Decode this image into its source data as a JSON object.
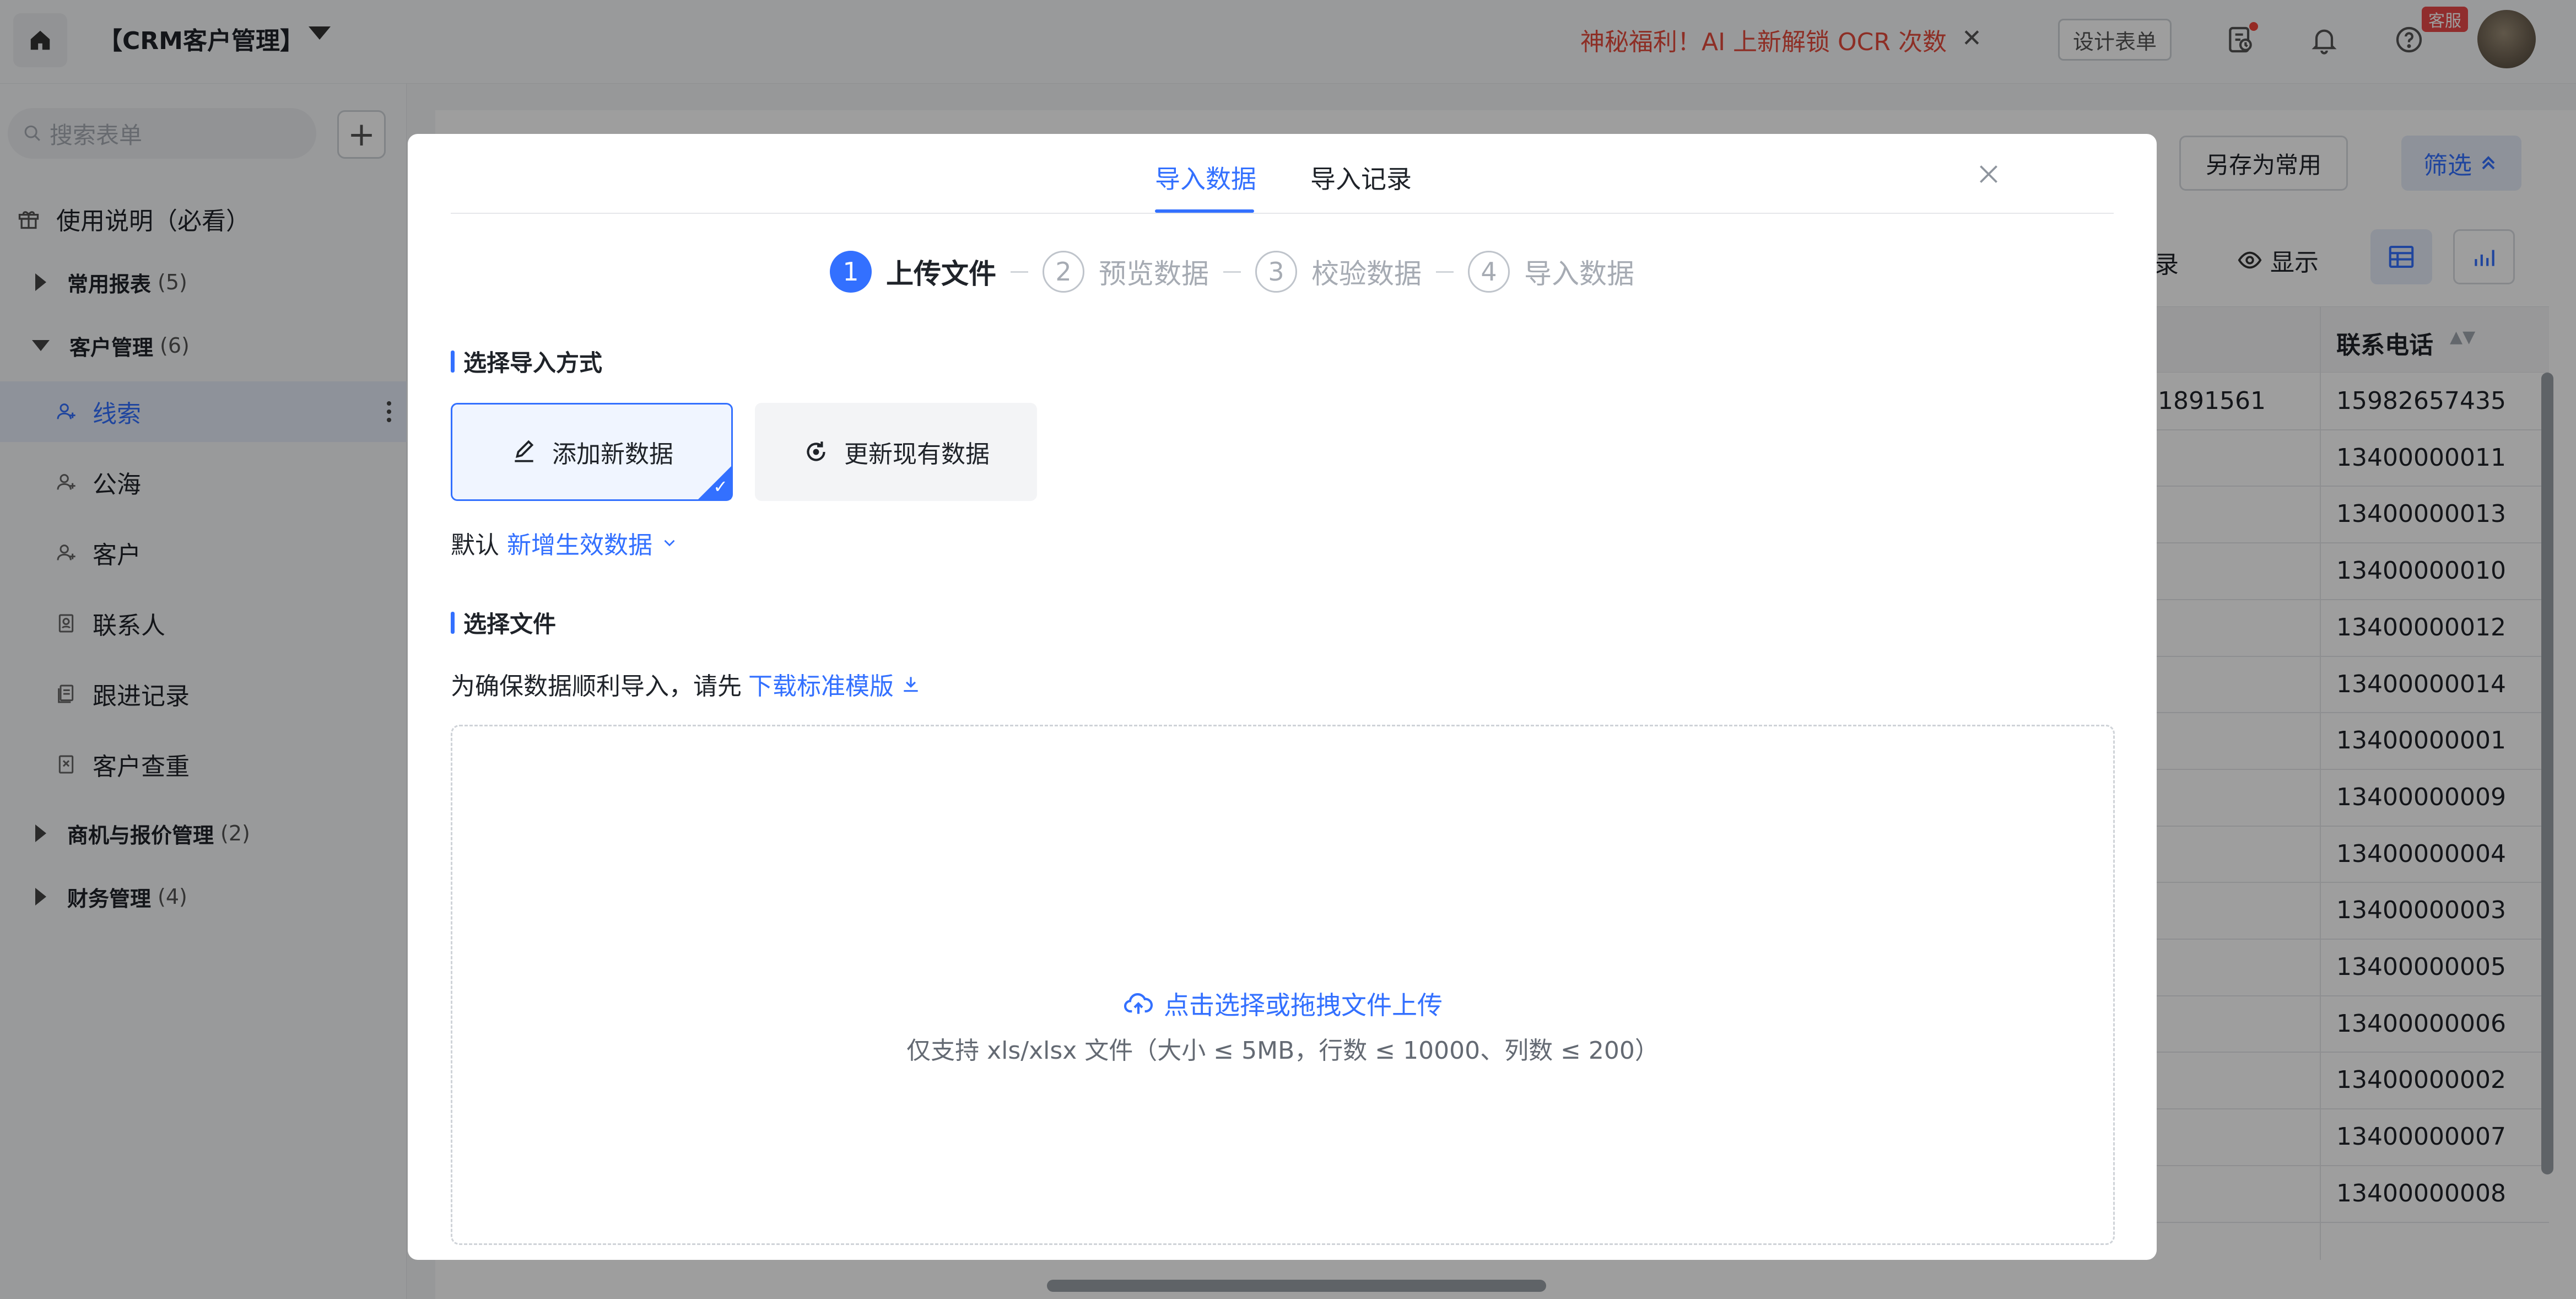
{
  "app": {
    "title": "【CRM客户管理】"
  },
  "topbar": {
    "promo": "神秘福利！AI 上新解锁 OCR 次数",
    "design_form": "设计表单",
    "kefu": "客服"
  },
  "sidebar": {
    "search_placeholder": "搜索表单",
    "guide": "使用说明（必看）",
    "groups": [
      {
        "label": "常用报表",
        "count": "(5)"
      },
      {
        "label": "客户管理",
        "count": "(6)"
      },
      {
        "label": "商机与报价管理",
        "count": "(2)"
      },
      {
        "label": "财务管理",
        "count": "(4)"
      }
    ],
    "items": [
      {
        "label": "线索"
      },
      {
        "label": "公海"
      },
      {
        "label": "客户"
      },
      {
        "label": "联系人"
      },
      {
        "label": "跟进记录"
      },
      {
        "label": "客户查重"
      }
    ]
  },
  "background": {
    "save_common": "另存为常用",
    "filter": "筛选",
    "record_partial": "录",
    "show": "显示",
    "column_header": "联系电话",
    "partial_value": "1891561",
    "phones": [
      "15982657435",
      "13400000011",
      "13400000013",
      "13400000010",
      "13400000012",
      "13400000014",
      "13400000001",
      "13400000009",
      "13400000004",
      "13400000003",
      "13400000005",
      "13400000006",
      "13400000002",
      "13400000007",
      "13400000008"
    ]
  },
  "modal": {
    "tabs": [
      "导入数据",
      "导入记录"
    ],
    "steps": [
      {
        "num": "1",
        "label": "上传文件"
      },
      {
        "num": "2",
        "label": "预览数据"
      },
      {
        "num": "3",
        "label": "校验数据"
      },
      {
        "num": "4",
        "label": "导入数据"
      }
    ],
    "section_mode": "选择导入方式",
    "mode_add": "添加新数据",
    "mode_update": "更新现有数据",
    "default_prefix": "默认",
    "default_option": "新增生效数据",
    "section_file": "选择文件",
    "note_prefix": "为确保数据顺利导入，请先",
    "download_template": "下载标准模版",
    "upload_text": "点击选择或拖拽文件上传",
    "upload_hint": "仅支持 xls/xlsx 文件（大小 ≤ 5MB，行数 ≤ 10000、列数 ≤ 200）"
  }
}
